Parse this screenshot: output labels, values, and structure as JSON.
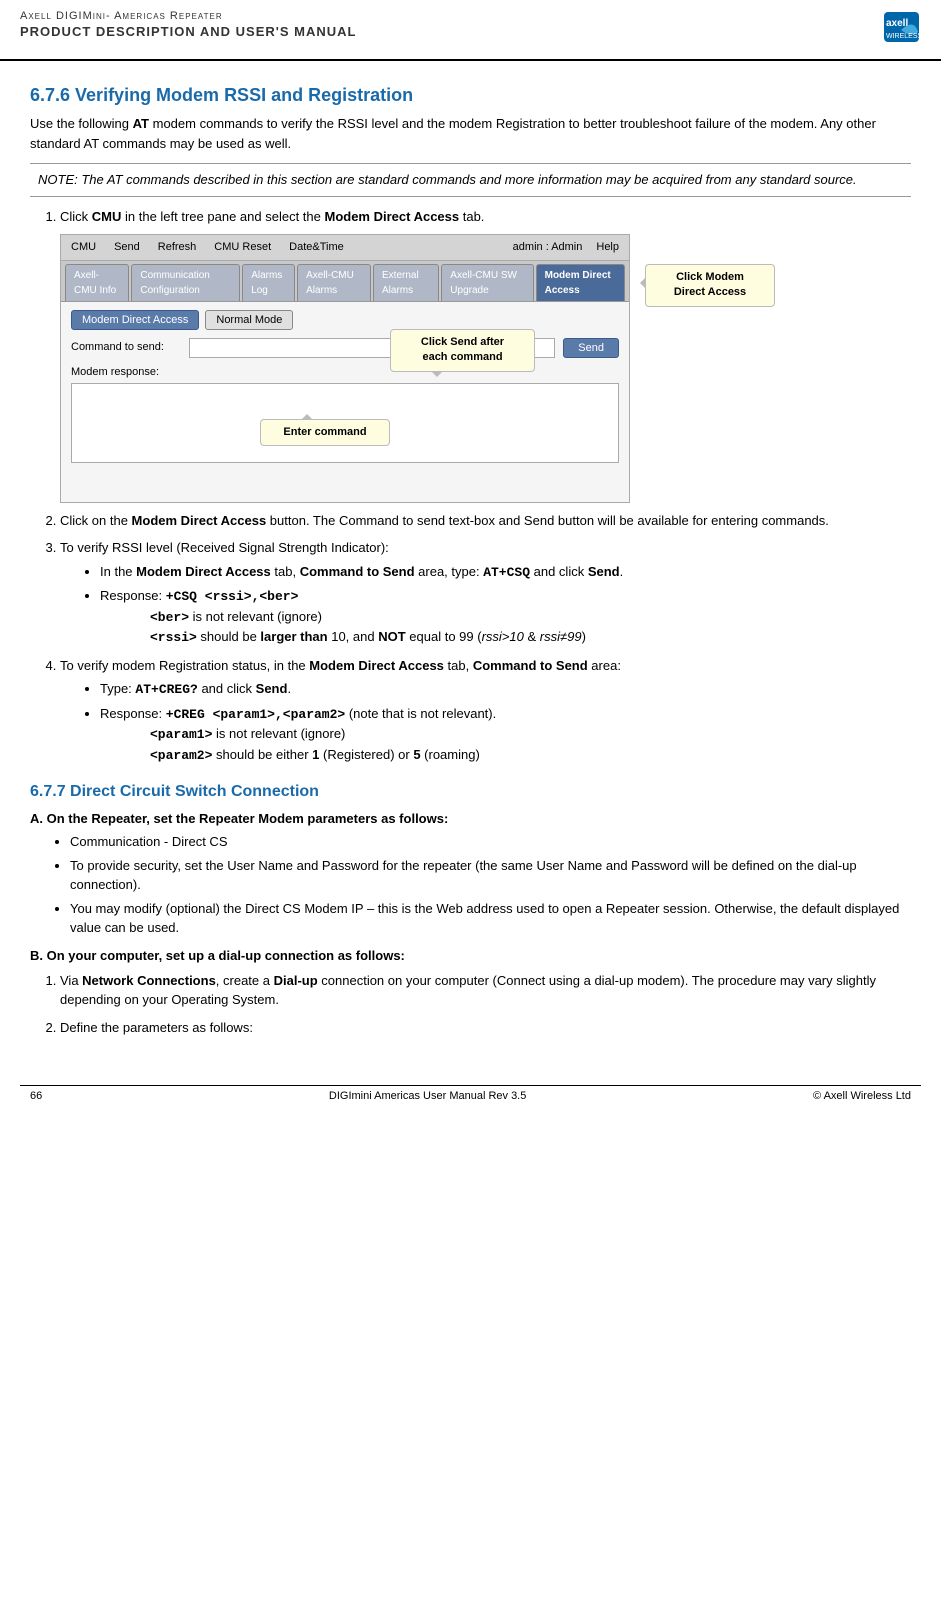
{
  "header": {
    "title_top": "Axell DIGIMini- Americas Repeater",
    "title_main": "PRODUCT DESCRIPTION AND USER'S MANUAL"
  },
  "section_677": {
    "heading": "6.7.6   Verifying Modem RSSI and Registration",
    "intro": "Use the following AT modem commands to verify the RSSI level and the modem Registration to better troubleshoot failure of the modem.  Any other standard AT command may be used as well.",
    "note": "NOTE: The AT commands described in this section are standard commands and more information may be acquired from any standard source.",
    "step1": "Click CMU in the left tree pane and select the Modem Direct Access tab.",
    "step2": "Click on the Modem Direct Access button. The Command to send text-box and Send button will be available for entering commands.",
    "step3": "To verify RSSI level (Received Signal Strength Indicator):",
    "step3_bullet1": "In the Modem Direct Access tab, Command to Send area, type: AT+CSQ and click Send.",
    "step3_bullet2": "Response: +CSQ <rssi>,<ber>",
    "step3_sub1": "<ber> is  not relevant (ignore)",
    "step3_sub2": "<rssi> should be larger than 10, and NOT equal to 99 (rssi>10 & rssi≠99)",
    "step4": "To verify modem Registration status, in the Modem Direct Access tab, Command to Send area:",
    "step4_bullet1": "Type: AT+CREG? and click Send.",
    "step4_bullet2": "Response:  +CREG <param1>,<param2>  (note that is not relevant).",
    "step4_sub1": "<param1> is not relevant (ignore)",
    "step4_sub2": "<param2> should be either 1 (Registered) or 5 (roaming)"
  },
  "section_677b": {
    "heading": "6.7.7   Direct Circuit Switch Connection",
    "partA_heading": "A. On the Repeater, set the Repeater Modem parameters as follows:",
    "partA_bullets": [
      "Communication - Direct CS",
      "To provide security, set the User Name and Password for the repeater (the same User Name and Password will be defined on the dial-up connection).",
      "You may modify (optional) the Direct CS Modem IP – this is the Web address used to open a Repeater session. Otherwise, the default displayed value can be used."
    ],
    "partB_heading": "B. On your computer, set up a dial-up connection as follows:",
    "partB_step1": "Via Network Connections, create a Dial-up connection on your computer (Connect using a dial-up modem).  The procedure may vary slightly depending on your Operating System.",
    "partB_step2": "Define the parameters as follows:"
  },
  "screenshot": {
    "topbar_items": [
      "CMU",
      "Send",
      "Refresh",
      "CMU Reset",
      "Date&Time",
      "admin : Admin",
      "Help"
    ],
    "tabs": [
      {
        "label": "Axell-CMU Info",
        "active": false
      },
      {
        "label": "Communication Configuration",
        "active": false
      },
      {
        "label": "Alarms Log",
        "active": false
      },
      {
        "label": "Axell-CMU Alarms",
        "active": false
      },
      {
        "label": "External Alarms",
        "active": false
      },
      {
        "label": "Axell-CMU SW Upgrade",
        "active": false
      },
      {
        "label": "Modem Direct Access",
        "active": true
      }
    ],
    "btn_modem_direct": "Modem Direct Access",
    "btn_normal_mode": "Normal Mode",
    "field_label": "Command to send:",
    "send_btn": "Send",
    "response_label": "Modem response:",
    "callout_right": "Click Modem\nDirect Access",
    "callout_send": "Click Send after\neach command",
    "callout_enter": "Enter command"
  },
  "footer": {
    "page_num": "66",
    "center": "DIGImini Americas User Manual Rev 3.5",
    "right": "© Axell Wireless Ltd"
  }
}
